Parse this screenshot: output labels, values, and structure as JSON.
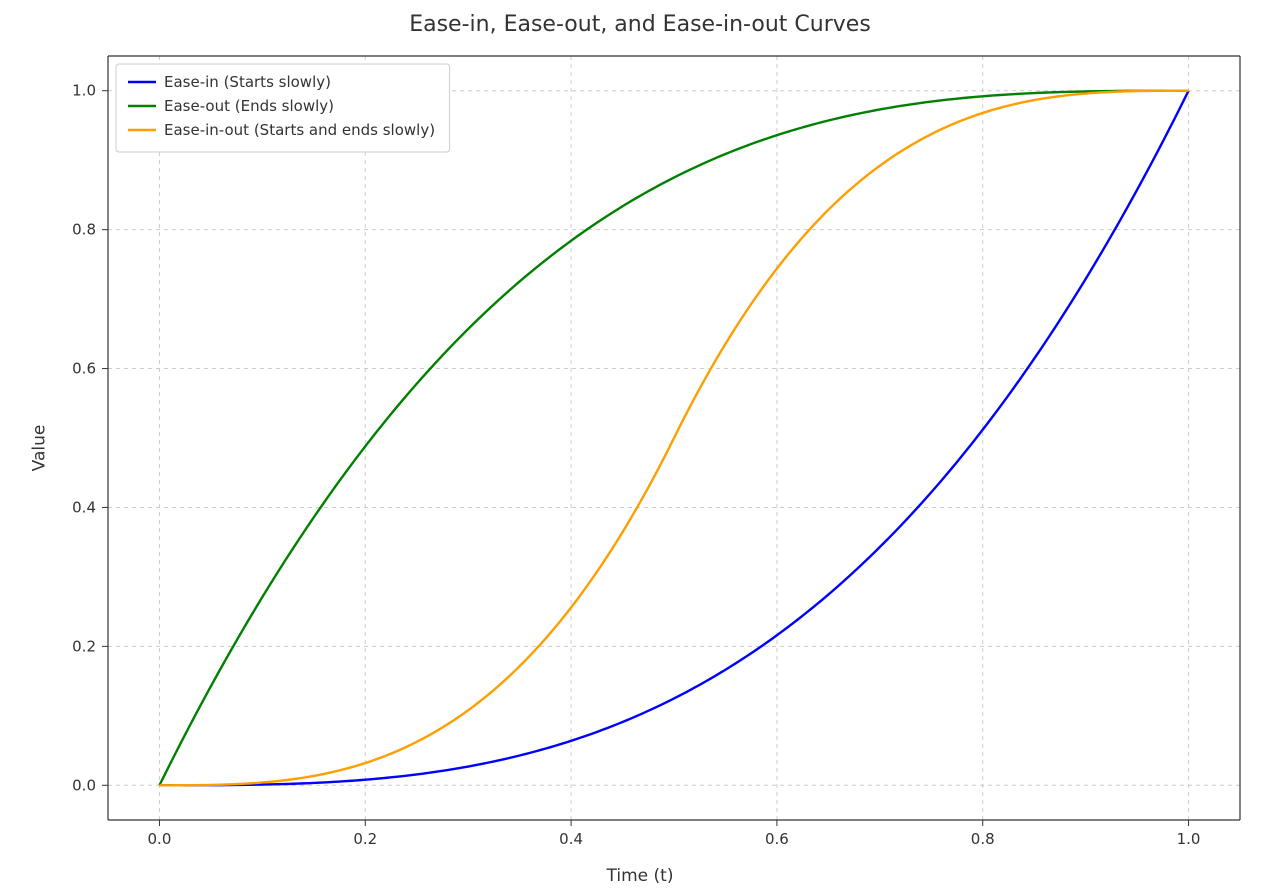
{
  "chart_data": {
    "type": "line",
    "title": "Ease-in, Ease-out, and Ease-in-out Curves",
    "xlabel": "Time (t)",
    "ylabel": "Value",
    "xlim": [
      -0.05,
      1.05
    ],
    "ylim": [
      -0.05,
      1.05
    ],
    "xticks": [
      0.0,
      0.2,
      0.4,
      0.6,
      0.8,
      1.0
    ],
    "yticks": [
      0.0,
      0.2,
      0.4,
      0.6,
      0.8,
      1.0
    ],
    "grid": true,
    "legend_position": "upper left",
    "x": [
      0.0,
      0.05,
      0.1,
      0.15,
      0.2,
      0.25,
      0.3,
      0.35,
      0.4,
      0.45,
      0.5,
      0.55,
      0.6,
      0.65,
      0.7,
      0.75,
      0.8,
      0.85,
      0.9,
      0.95,
      1.0
    ],
    "series": [
      {
        "name": "Ease-in (Starts slowly)",
        "color": "#0000ff",
        "formula": "t^3",
        "values": [
          0.0,
          0.0,
          0.001,
          0.003,
          0.008,
          0.016,
          0.027,
          0.043,
          0.064,
          0.091,
          0.125,
          0.166,
          0.216,
          0.275,
          0.343,
          0.422,
          0.512,
          0.614,
          0.729,
          0.857,
          1.0
        ]
      },
      {
        "name": "Ease-out (Ends slowly)",
        "color": "#008000",
        "formula": "1 - (1 - t)^3",
        "values": [
          0.0,
          0.143,
          0.271,
          0.386,
          0.488,
          0.578,
          0.657,
          0.725,
          0.784,
          0.834,
          0.875,
          0.909,
          0.936,
          0.957,
          0.973,
          0.984,
          0.992,
          0.997,
          0.999,
          1.0,
          1.0
        ]
      },
      {
        "name": "Ease-in-out (Starts and ends slowly)",
        "color": "#ff9e00",
        "formula": "t<0.5 ? 4t^3 : 1 - (-2t+2)^3/2",
        "values": [
          0.0,
          0.001,
          0.004,
          0.014,
          0.032,
          0.063,
          0.108,
          0.172,
          0.256,
          0.365,
          0.5,
          0.636,
          0.744,
          0.829,
          0.892,
          0.938,
          0.968,
          0.987,
          0.996,
          1.0,
          1.0
        ]
      }
    ]
  }
}
